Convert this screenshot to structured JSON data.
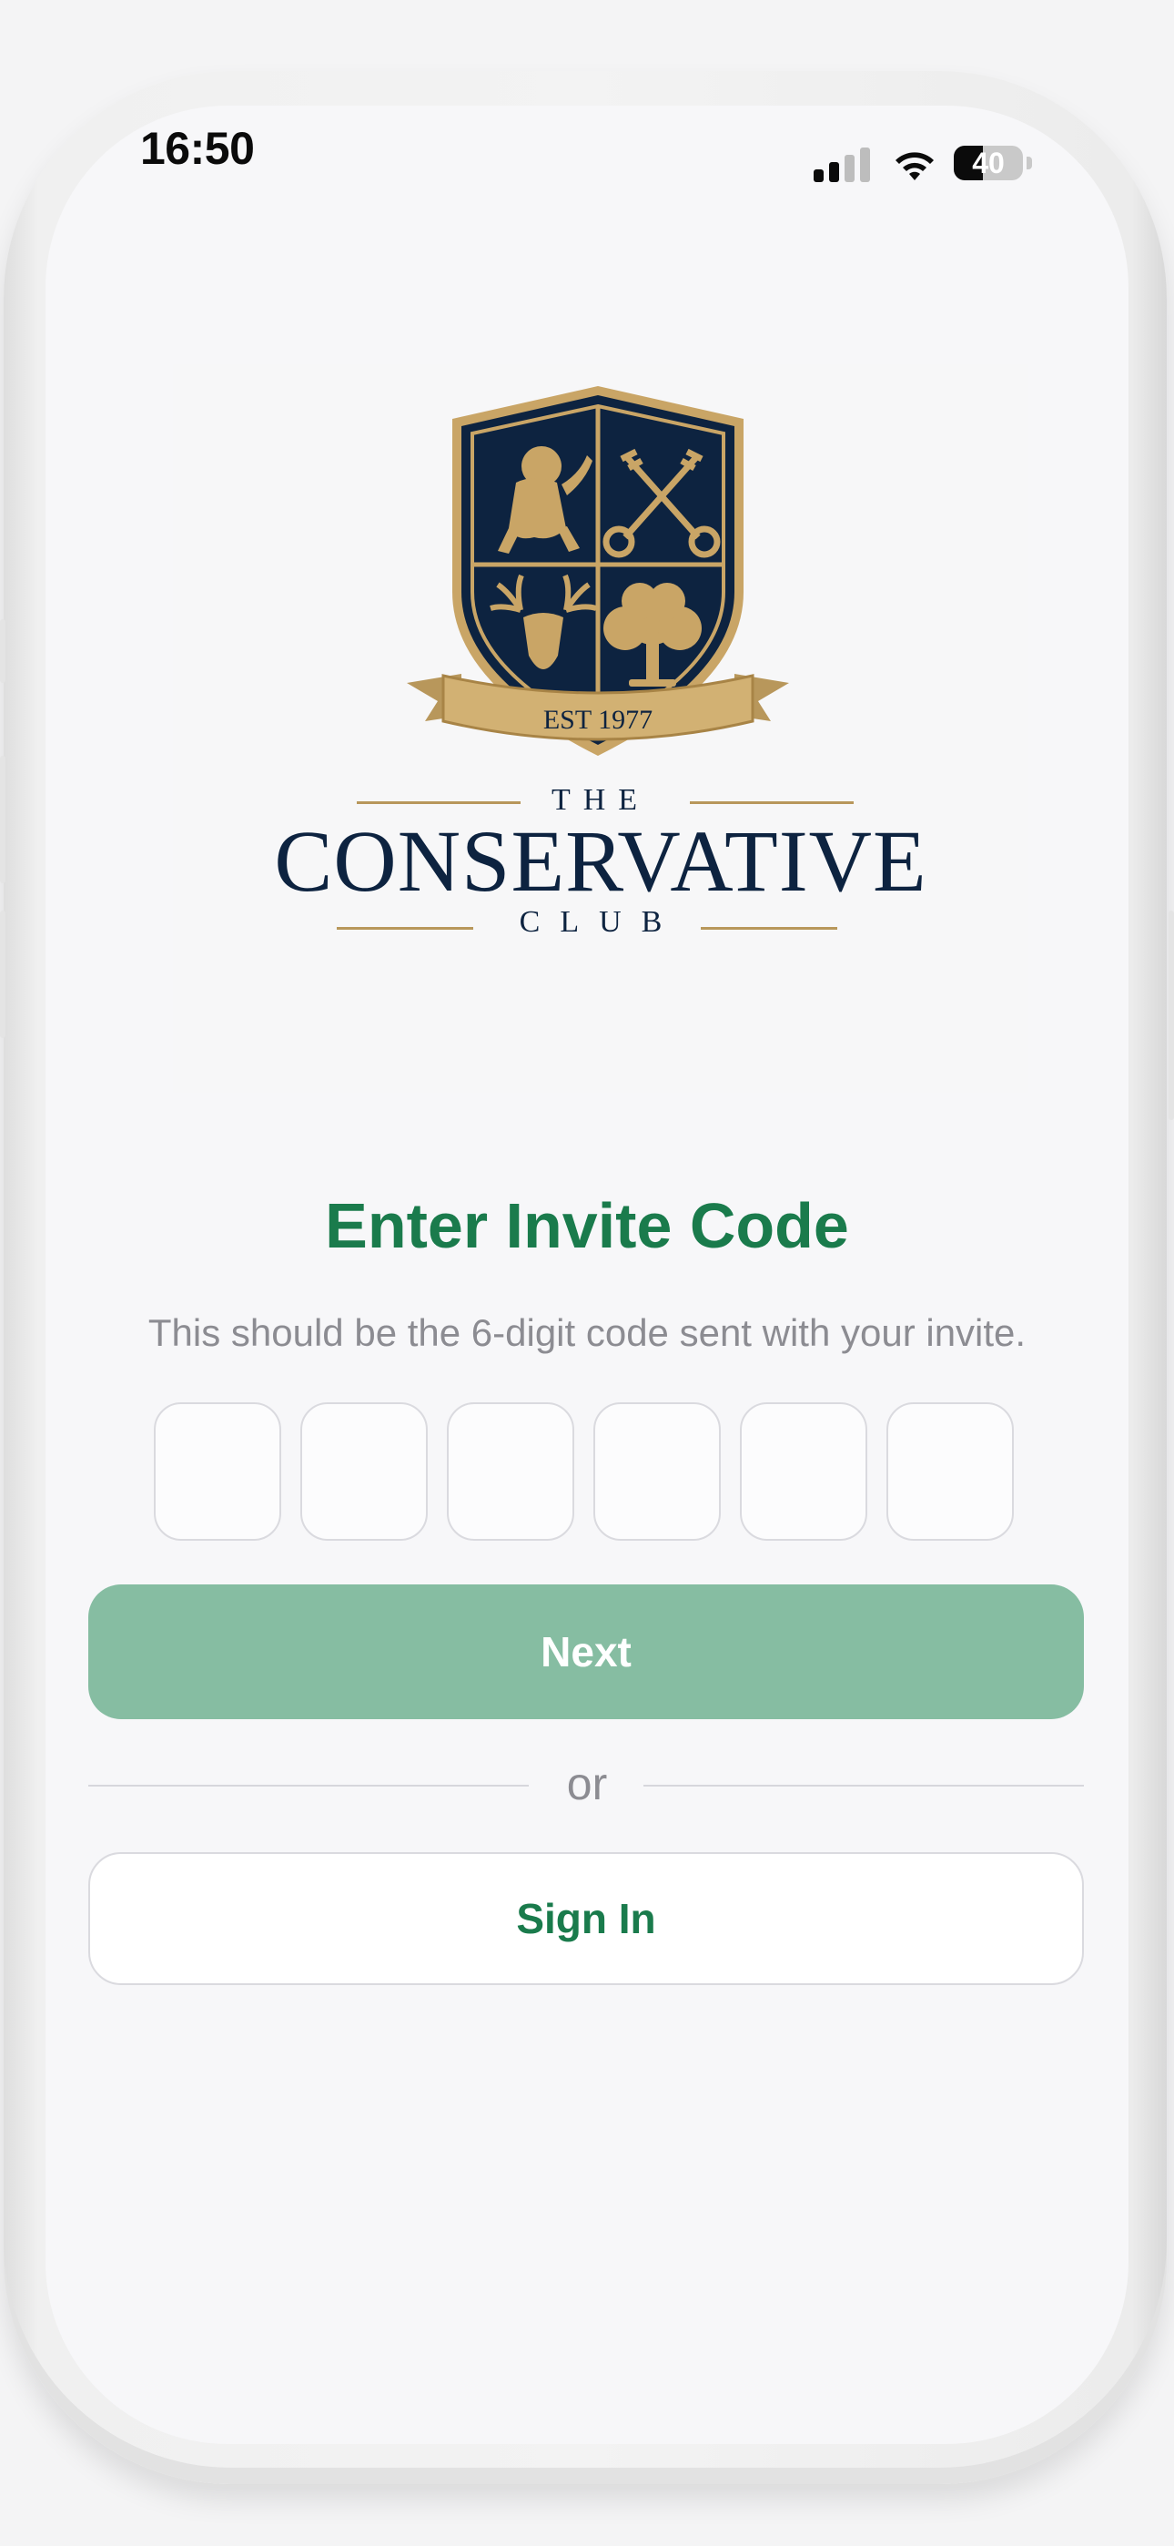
{
  "status_bar": {
    "time": "16:50",
    "battery_level": "40",
    "signal_icon": "cellular-signal-icon",
    "wifi_icon": "wifi-icon",
    "battery_icon": "battery-icon"
  },
  "logo": {
    "banner_text": "EST 1977",
    "line_the": "THE",
    "line_name": "CONSERVATIVE",
    "line_club": "CLUB",
    "colors": {
      "navy": "#0d2340",
      "gold": "#c9a566"
    }
  },
  "invite": {
    "title": "Enter Invite Code",
    "subtitle": "This should be the 6-digit code sent with your invite.",
    "code_digits": [
      "",
      "",
      "",
      "",
      "",
      ""
    ]
  },
  "actions": {
    "next_label": "Next",
    "or_label": "or",
    "signin_label": "Sign In"
  },
  "colors": {
    "accent_green": "#1a7b4c",
    "next_button_disabled": "#86bda2",
    "background": "#f7f7f9"
  }
}
